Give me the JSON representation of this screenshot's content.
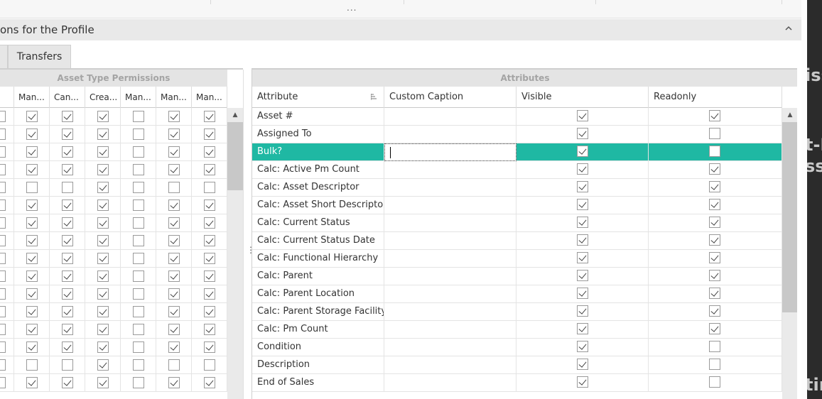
{
  "section": {
    "title": "ons for the Profile"
  },
  "tabs": {
    "active_label": "Transfers"
  },
  "left": {
    "group_title": "Asset Type Permissions",
    "columns": [
      "",
      "Man...",
      "Can...",
      "Crea...",
      "Man...",
      "Man...",
      "Man..."
    ],
    "rows": [
      [
        0,
        1,
        1,
        1,
        0,
        1,
        1
      ],
      [
        0,
        1,
        1,
        1,
        0,
        1,
        1
      ],
      [
        0,
        1,
        1,
        1,
        0,
        1,
        1
      ],
      [
        0,
        1,
        1,
        1,
        0,
        1,
        1
      ],
      [
        0,
        0,
        0,
        1,
        0,
        0,
        0
      ],
      [
        0,
        1,
        1,
        1,
        0,
        1,
        1
      ],
      [
        0,
        1,
        1,
        1,
        0,
        1,
        1
      ],
      [
        0,
        1,
        1,
        1,
        0,
        1,
        1
      ],
      [
        0,
        1,
        1,
        1,
        0,
        1,
        1
      ],
      [
        0,
        1,
        1,
        1,
        0,
        1,
        1
      ],
      [
        0,
        1,
        1,
        1,
        0,
        1,
        1
      ],
      [
        0,
        1,
        1,
        1,
        0,
        1,
        1
      ],
      [
        0,
        1,
        1,
        1,
        0,
        1,
        1
      ],
      [
        0,
        1,
        1,
        1,
        0,
        1,
        1
      ],
      [
        0,
        0,
        0,
        1,
        0,
        0,
        0
      ],
      [
        0,
        1,
        1,
        1,
        0,
        1,
        1
      ]
    ]
  },
  "right": {
    "group_title": "Attributes",
    "columns": [
      "Attribute",
      "Custom Caption",
      "Visible",
      "Readonly"
    ],
    "rows": [
      {
        "attribute": "Asset #",
        "caption": "",
        "visible": true,
        "readonly": true
      },
      {
        "attribute": "Assigned To",
        "caption": "",
        "visible": true,
        "readonly": false
      },
      {
        "attribute": "Bulk?",
        "caption": "",
        "visible": true,
        "readonly": false,
        "selected": true
      },
      {
        "attribute": "Calc: Active Pm Count",
        "caption": "",
        "visible": true,
        "readonly": true
      },
      {
        "attribute": "Calc: Asset Descriptor",
        "caption": "",
        "visible": true,
        "readonly": true
      },
      {
        "attribute": "Calc: Asset Short Descriptor",
        "caption": "",
        "visible": true,
        "readonly": true
      },
      {
        "attribute": "Calc: Current Status",
        "caption": "",
        "visible": true,
        "readonly": true
      },
      {
        "attribute": "Calc: Current Status Date",
        "caption": "",
        "visible": true,
        "readonly": true
      },
      {
        "attribute": "Calc: Functional Hierarchy",
        "caption": "",
        "visible": true,
        "readonly": true
      },
      {
        "attribute": "Calc: Parent",
        "caption": "",
        "visible": true,
        "readonly": true
      },
      {
        "attribute": "Calc: Parent Location",
        "caption": "",
        "visible": true,
        "readonly": true
      },
      {
        "attribute": "Calc: Parent Storage Facility",
        "caption": "",
        "visible": true,
        "readonly": true
      },
      {
        "attribute": "Calc: Pm Count",
        "caption": "",
        "visible": true,
        "readonly": true
      },
      {
        "attribute": "Condition",
        "caption": "",
        "visible": true,
        "readonly": false
      },
      {
        "attribute": "Description",
        "caption": "",
        "visible": true,
        "readonly": false
      },
      {
        "attribute": "End of Sales",
        "caption": "",
        "visible": true,
        "readonly": false
      }
    ]
  },
  "topbar": {
    "overflow": "..."
  },
  "splitter": {
    "grip": "⋮"
  },
  "scrollbar": {
    "up_arrow": "▲"
  },
  "side_text": [
    "iss",
    "t-I",
    "ss",
    "tir"
  ],
  "colors": {
    "selected_row": "#1fb8a3",
    "header_bg": "#e9e9e9"
  }
}
